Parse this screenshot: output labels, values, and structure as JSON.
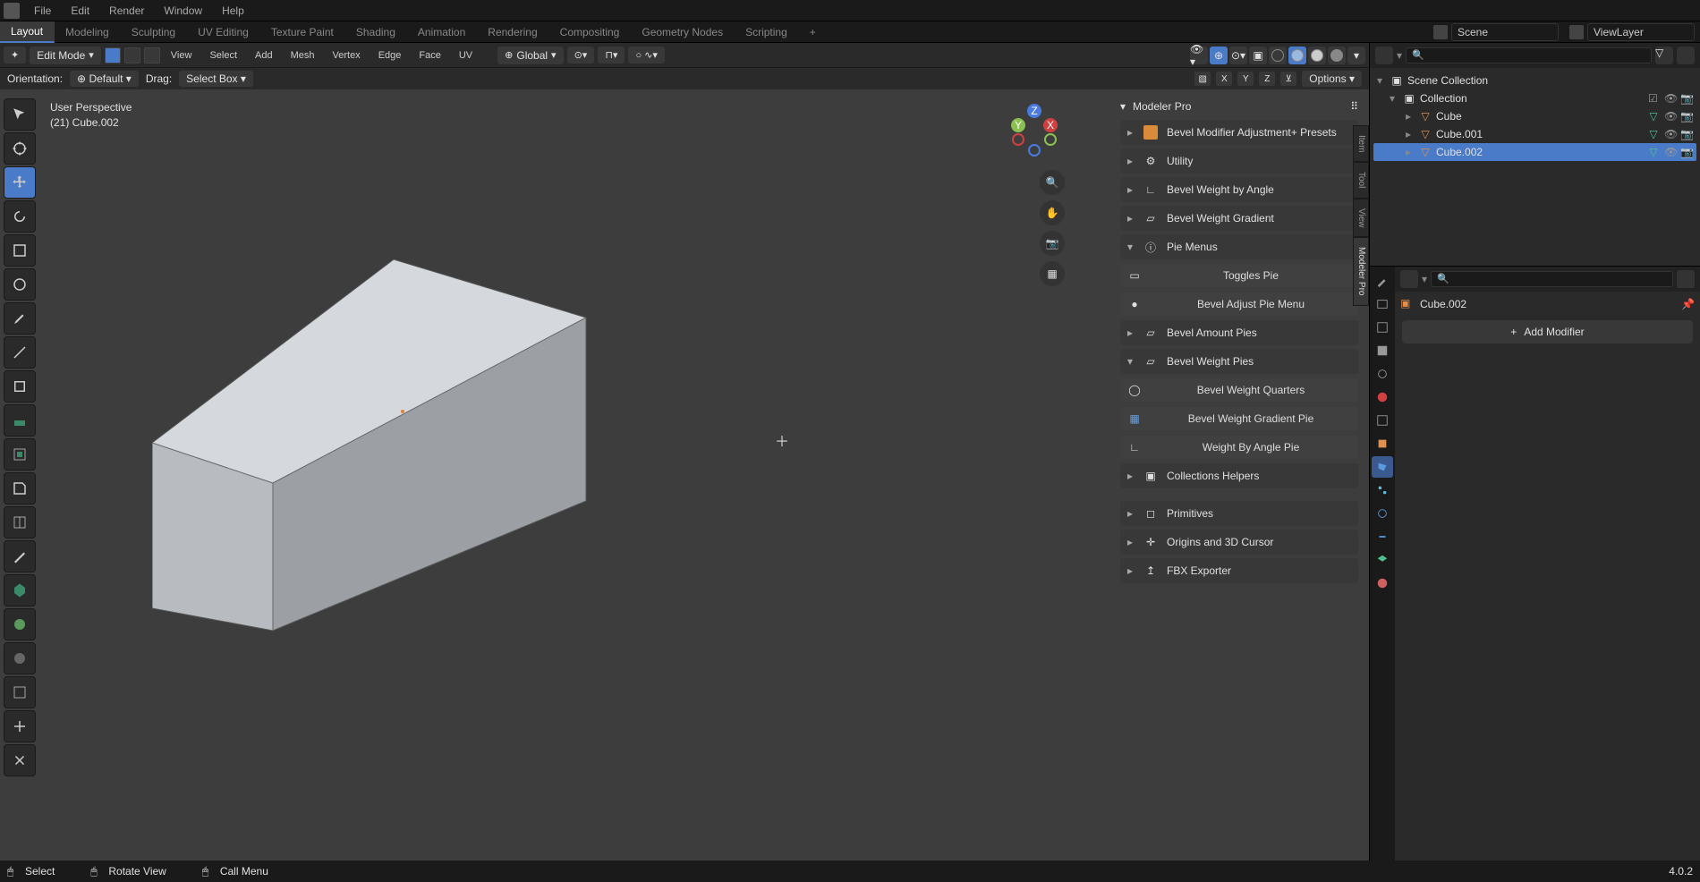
{
  "app_menu": [
    "File",
    "Edit",
    "Render",
    "Window",
    "Help"
  ],
  "workspaces": [
    "Layout",
    "Modeling",
    "Sculpting",
    "UV Editing",
    "Texture Paint",
    "Shading",
    "Animation",
    "Rendering",
    "Compositing",
    "Geometry Nodes",
    "Scripting"
  ],
  "active_workspace": "Layout",
  "scene_name": "Scene",
  "viewlayer_name": "ViewLayer",
  "mode": "Edit Mode",
  "view_menu": [
    "View",
    "Select",
    "Add",
    "Mesh",
    "Vertex",
    "Edge",
    "Face",
    "UV"
  ],
  "transform_orientation": "Global",
  "orientation_label": "Orientation:",
  "orientation_value": "Default",
  "drag_label": "Drag:",
  "drag_value": "Select Box",
  "options_label": "Options",
  "axes": [
    "X",
    "Y",
    "Z"
  ],
  "viewport_info_line1": "User Perspective",
  "viewport_info_line2": "(21) Cube.002",
  "sidepanel": {
    "title": "Modeler Pro",
    "tabs": [
      "Item",
      "Tool",
      "View",
      "Modeler Pro"
    ],
    "sections": [
      {
        "label": "Bevel Modifier Adjustment+ Presets",
        "icon": "#d98b3a",
        "open": false
      },
      {
        "label": "Utility",
        "icon": "#888",
        "open": false
      },
      {
        "label": "Bevel Weight by Angle",
        "icon": "#888",
        "open": false
      },
      {
        "label": "Bevel Weight Gradient",
        "icon": "#888",
        "open": false
      },
      {
        "label": "Pie Menus",
        "icon": "#888",
        "open": true,
        "children": [
          {
            "label": "Toggles Pie",
            "icon": "▭"
          },
          {
            "label": "Bevel Adjust Pie Menu",
            "icon": "●"
          }
        ]
      },
      {
        "label": "Bevel Amount Pies",
        "icon": "#888",
        "open": false
      },
      {
        "label": "Bevel Weight Pies",
        "icon": "#888",
        "open": true,
        "children": [
          {
            "label": "Bevel Weight Quarters",
            "icon": "◯"
          },
          {
            "label": "Bevel Weight Gradient Pie",
            "icon": "▦"
          },
          {
            "label": "Weight By Angle Pie",
            "icon": "∟"
          }
        ]
      },
      {
        "label": "Collections Helpers",
        "icon": "#888",
        "open": false
      },
      {
        "label": "Primitives",
        "icon": "#888",
        "open": false
      },
      {
        "label": "Origins and 3D Cursor",
        "icon": "#888",
        "open": false
      },
      {
        "label": "FBX Exporter",
        "icon": "#888",
        "open": false
      }
    ]
  },
  "outliner": {
    "root": "Scene Collection",
    "collection": "Collection",
    "items": [
      {
        "name": "Cube",
        "selected": false
      },
      {
        "name": "Cube.001",
        "selected": false
      },
      {
        "name": "Cube.002",
        "selected": true
      }
    ]
  },
  "props": {
    "object_name": "Cube.002",
    "add_modifier": "Add Modifier"
  },
  "footer": {
    "select": "Select",
    "rotate": "Rotate View",
    "menu": "Call Menu",
    "version": "4.0.2"
  }
}
